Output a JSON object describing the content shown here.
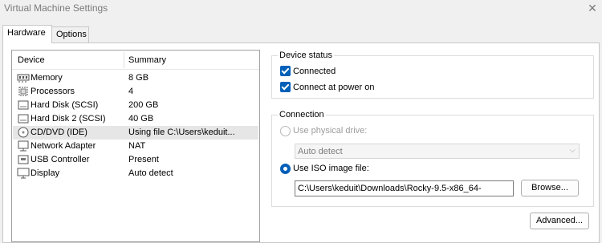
{
  "window": {
    "title": "Virtual Machine Settings"
  },
  "tabs": [
    {
      "label": "Hardware"
    },
    {
      "label": "Options"
    }
  ],
  "device_list": {
    "columns": [
      "Device",
      "Summary"
    ],
    "rows": [
      {
        "name": "Memory",
        "summary": "8 GB",
        "icon": "memory-icon"
      },
      {
        "name": "Processors",
        "summary": "4",
        "icon": "processor-icon"
      },
      {
        "name": "Hard Disk (SCSI)",
        "summary": "200 GB",
        "icon": "hard-disk-icon"
      },
      {
        "name": "Hard Disk 2 (SCSI)",
        "summary": "40 GB",
        "icon": "hard-disk-icon"
      },
      {
        "name": "CD/DVD (IDE)",
        "summary": "Using file C:\\Users\\keduit...",
        "icon": "cd-dvd-icon",
        "selected": true
      },
      {
        "name": "Network Adapter",
        "summary": "NAT",
        "icon": "network-adapter-icon"
      },
      {
        "name": "USB Controller",
        "summary": "Present",
        "icon": "usb-controller-icon"
      },
      {
        "name": "Display",
        "summary": "Auto detect",
        "icon": "display-icon"
      }
    ]
  },
  "device_status": {
    "title": "Device status",
    "connected": {
      "label": "Connected",
      "checked": true
    },
    "connect_at_power_on": {
      "label": "Connect at power on",
      "checked": true
    }
  },
  "connection": {
    "title": "Connection",
    "physical_drive": {
      "label": "Use physical drive:",
      "enabled": false,
      "selected": false
    },
    "drive_select": {
      "value": "Auto detect"
    },
    "iso_image": {
      "label": "Use ISO image file:",
      "selected": true
    },
    "iso_path": {
      "value": "C:\\Users\\keduit\\Downloads\\Rocky-9.5-x86_64-"
    },
    "browse": {
      "label": "Browse..."
    }
  },
  "advanced": {
    "label": "Advanced..."
  },
  "colors": {
    "accent": "#005fb8",
    "selected_row": "#e6e6e6",
    "disabled_text": "#9c9c9c"
  }
}
